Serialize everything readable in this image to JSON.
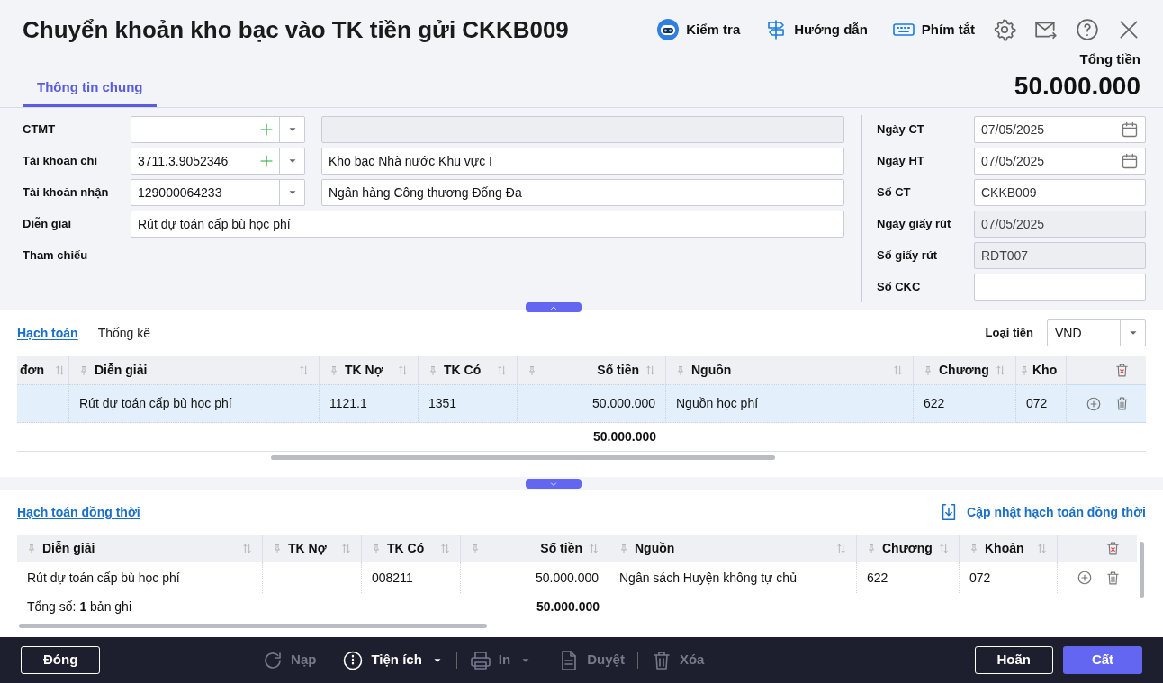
{
  "window": {
    "title": "Chuyển khoản kho bạc vào TK tiền gửi CKKB009"
  },
  "header_actions": [
    {
      "kind": "check",
      "label": "Kiểm tra"
    },
    {
      "kind": "guide",
      "label": "Hướng dẫn"
    },
    {
      "kind": "shortcut",
      "label": "Phím tắt"
    }
  ],
  "total": {
    "label": "Tổng tiền",
    "value": "50.000.000"
  },
  "tabs": [
    {
      "label": "Thông tin chung",
      "selected": true
    }
  ],
  "left_fields": [
    {
      "kind": "combo",
      "label": "CTMT",
      "addable": true,
      "name_disabled": true
    },
    {
      "kind": "combo",
      "label": "Tài khoản chi",
      "value": "3711.3.9052346",
      "addable": true,
      "name_value": "Kho bạc Nhà nước Khu vực I",
      "name_disabled": false
    },
    {
      "kind": "combo",
      "label": "Tài khoản nhận",
      "value": "129000064233",
      "addable": false,
      "name_value": "Ngân hàng Công thương Đống Đa",
      "name_disabled": false
    },
    {
      "kind": "text",
      "label": "Diễn giải",
      "value": "Rút dự toán cấp bù học phí"
    },
    {
      "kind": "label",
      "label": "Tham chiếu"
    }
  ],
  "right_fields": [
    {
      "kind": "date",
      "label": "Ngày CT",
      "value": "07/05/2025",
      "disabled": false
    },
    {
      "kind": "date",
      "label": "Ngày HT",
      "value": "07/05/2025",
      "disabled": false
    },
    {
      "kind": "text",
      "label": "Số CT",
      "value": "CKKB009",
      "disabled": false
    },
    {
      "kind": "text",
      "label": "Ngày giấy rút",
      "value": "07/05/2025",
      "disabled": true
    },
    {
      "kind": "text",
      "label": "Số giấy rút",
      "value": "RDT007",
      "disabled": true
    },
    {
      "kind": "text",
      "label": "Số CKC",
      "disabled": false
    }
  ],
  "entries": {
    "subtabs": [
      {
        "label": "Hạch toán",
        "selected": true
      },
      {
        "label": "Thống kê",
        "selected": false
      }
    ],
    "currency": {
      "label": "Loại tiền",
      "value": "VND"
    },
    "columns": [
      {
        "label": "đơn"
      },
      {
        "label": "Diễn giải"
      },
      {
        "label": "TK Nợ"
      },
      {
        "label": "TK Có"
      },
      {
        "label": "Số tiền",
        "total": "50.000.000"
      },
      {
        "label": "Nguồn"
      },
      {
        "label": "Chương"
      },
      {
        "label": "Kho"
      }
    ],
    "rows": [
      {
        "selected": true,
        "cells": [
          "",
          "Rút dự toán cấp bù học phí",
          "1121.1",
          "1351",
          "50.000.000",
          "Nguồn học phí",
          "622",
          "072"
        ]
      }
    ]
  },
  "simultaneous": {
    "title": "Hạch toán đồng thời",
    "update_action": "Cập nhật hạch toán đồng thời",
    "columns": [
      {
        "label": "Diễn giải"
      },
      {
        "label": "TK Nợ"
      },
      {
        "label": "TK Có"
      },
      {
        "label": "Số tiền",
        "total": "50.000.000"
      },
      {
        "label": "Nguồn"
      },
      {
        "label": "Chương"
      },
      {
        "label": "Khoản"
      }
    ],
    "rows": [
      {
        "selected": false,
        "cells": [
          "Rút dự toán cấp bù học phí",
          "",
          "008211",
          "50.000.000",
          "Ngân sách Huyện không tự chủ",
          "622",
          "072"
        ]
      }
    ],
    "record_count": "Tổng số: **1** bản ghi"
  },
  "footer": {
    "close": "Đóng",
    "tools": [
      {
        "kind": "reload",
        "label": "Nạp",
        "disabled": true,
        "dropdown": false
      },
      {
        "kind": "utility",
        "label": "Tiện ích",
        "disabled": false,
        "dropdown": true
      },
      {
        "kind": "print",
        "label": "In",
        "disabled": true,
        "dropdown": true
      },
      {
        "kind": "approve",
        "label": "Duyệt",
        "disabled": true,
        "dropdown": false
      },
      {
        "kind": "delete",
        "label": "Xóa",
        "disabled": true,
        "dropdown": false
      }
    ],
    "cancel": "Hoãn",
    "save": "Cất"
  }
}
